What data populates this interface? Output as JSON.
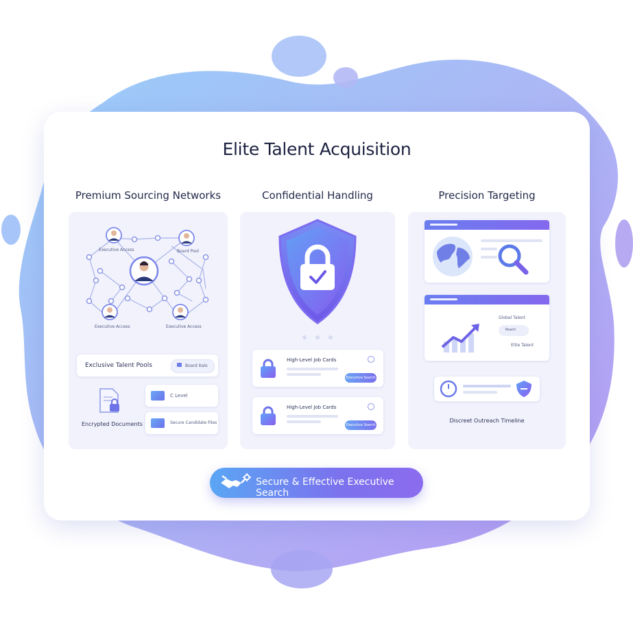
{
  "page": {
    "title": "Elite Talent Acquisition",
    "cta_label": "Secure & Effective Executive Search"
  },
  "colors": {
    "accent_blue": "#5aa6f4",
    "accent_purple": "#7b6cee",
    "panel_bg": "#f1f2fc",
    "title_text": "#1c2140"
  },
  "columns": [
    {
      "title": "Premium Sourcing Networks",
      "network_labels": [
        "Executive Access",
        "Board Pool",
        "Executive Access",
        "Executive Access"
      ],
      "pool_label": "Exclusive Talent Pools",
      "pool_badge": "Board Italo",
      "doc_label": "Encrypted Documents",
      "folders": [
        "C Level",
        "Secure Candidate Files"
      ]
    },
    {
      "title": "Confidential Handling",
      "job_cards": [
        {
          "title": "High-Level Job Cards",
          "button": "Executive Search"
        },
        {
          "title": "High-Level Job Cards",
          "button": "Executive Search"
        }
      ]
    },
    {
      "title": "Precision Targeting",
      "chart_badge": "Global Talent",
      "chart_sub": "Elite Talent",
      "chart_mini": "Reach",
      "timeline_label": "Discreet Outreach Timeline"
    }
  ],
  "icons": [
    "handshake-icon",
    "gear-icon",
    "lock-icon",
    "shield-icon",
    "checkmark-icon",
    "globe-icon",
    "magnifier-icon",
    "trend-chart-icon",
    "clock-icon",
    "folder-icon",
    "document-icon",
    "avatar-icon"
  ]
}
